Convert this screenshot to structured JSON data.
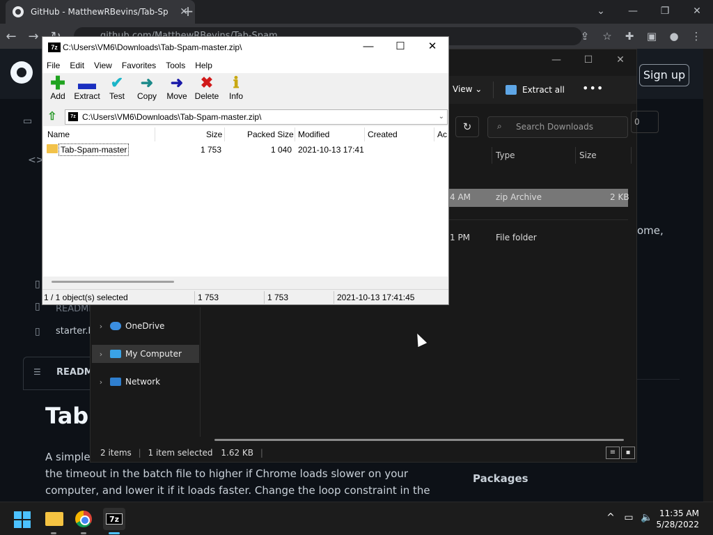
{
  "browser": {
    "tab_title": "GitHub - MatthewRBevins/Tab-Sp",
    "url": "github.com/MatthewRBevins/Tab-Spam"
  },
  "github": {
    "signup_label": "Sign up",
    "files": [
      "README",
      "starter.b"
    ],
    "readme_label": "READM",
    "readme_title": "Tab-",
    "readme_text": "A simple program to spam tabs in Chrome. Change the timeout in the batch file to higher if Chrome loads slower on your computer, and lower it if it loads faster. Change the loop constraint in the",
    "readme_lines": [
      "A simple p",
      "the timeout in the batch file to higher if Chrome loads slower on your",
      "computer, and lower it if it loads faster. Change the loop constraint in the"
    ],
    "right_text": "ome,",
    "packages_label": "Packages"
  },
  "explorer": {
    "view_label": "View",
    "extract_all_label": "Extract all",
    "search_placeholder": "Search Downloads",
    "count_badge": "0",
    "columns": [
      "Type",
      "Size"
    ],
    "rows": [
      {
        "time": "4 AM",
        "type": "zip Archive",
        "size": "2 KB"
      },
      {
        "time": "1 PM",
        "type": "File folder",
        "size": ""
      }
    ],
    "nav_items": [
      "OneDrive",
      "My Computer",
      "Network"
    ],
    "status": {
      "items": "2 items",
      "selected": "1 item selected",
      "size": "1.62 KB"
    }
  },
  "sevenzip": {
    "title": "C:\\Users\\VM6\\Downloads\\Tab-Spam-master.zip\\",
    "menu": [
      "File",
      "Edit",
      "View",
      "Favorites",
      "Tools",
      "Help"
    ],
    "toolbar": [
      {
        "label": "Add",
        "icon": "plus-icon",
        "color": "#1fa31f"
      },
      {
        "label": "Extract",
        "icon": "minus-icon",
        "color": "#1a2fbf"
      },
      {
        "label": "Test",
        "icon": "check-icon",
        "color": "#1bb5c8"
      },
      {
        "label": "Copy",
        "icon": "arrow-right-icon",
        "color": "#1c8a8a"
      },
      {
        "label": "Move",
        "icon": "arrow-right-icon",
        "color": "#1a1aa8"
      },
      {
        "label": "Delete",
        "icon": "x-icon",
        "color": "#d11a1a"
      },
      {
        "label": "Info",
        "icon": "info-icon",
        "color": "#c8a812"
      }
    ],
    "address": "C:\\Users\\VM6\\Downloads\\Tab-Spam-master.zip\\",
    "columns": [
      "Name",
      "Size",
      "Packed Size",
      "Modified",
      "Created",
      "Ac"
    ],
    "row": {
      "name": "Tab-Spam-master",
      "size": "1 753",
      "packed": "1 040",
      "modified": "2021-10-13 17:41"
    },
    "status": {
      "selected": "1 / 1 object(s) selected",
      "size": "1 753",
      "packed": "1 753",
      "modified": "2021-10-13 17:41:45"
    }
  },
  "taskbar": {
    "time": "11:35 AM",
    "date": "5/28/2022"
  }
}
